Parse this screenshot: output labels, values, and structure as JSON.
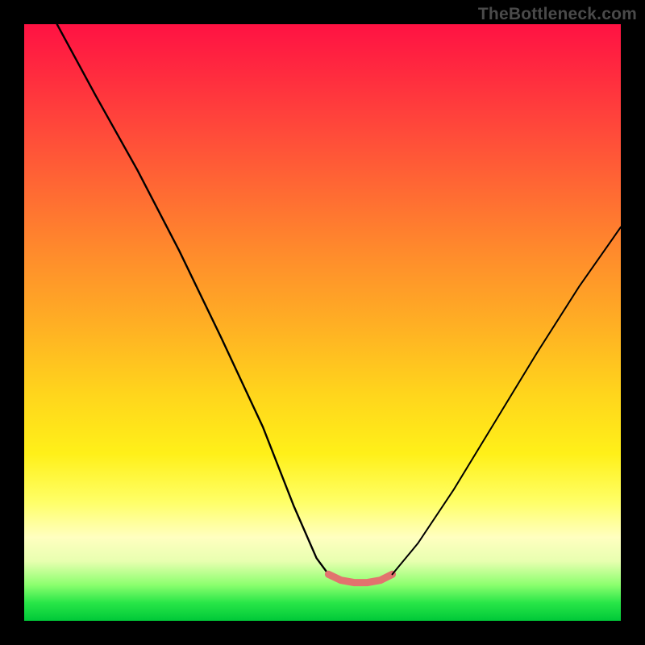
{
  "watermark": {
    "text": "TheBottleneck.com"
  },
  "colors": {
    "page_bg": "#000000",
    "watermark_text": "#4a4a4a",
    "curve": "#000000",
    "flat_segment": "#e2736e",
    "gradient_stops": [
      "#ff1243",
      "#ff2a3f",
      "#ff4a3a",
      "#ff6a33",
      "#ff8a2c",
      "#ffae24",
      "#ffd51c",
      "#fff019",
      "#ffff66",
      "#ffffc0",
      "#e8ffb0",
      "#8bff6e",
      "#28e648",
      "#00c838"
    ]
  },
  "chart_data": {
    "type": "line",
    "title": "",
    "xlabel": "",
    "ylabel": "",
    "xlim_norm": [
      0,
      1
    ],
    "ylim_norm": [
      0,
      1
    ],
    "series": [
      {
        "name": "left-descending-curve",
        "points_norm": [
          [
            0.055,
            0.0
          ],
          [
            0.12,
            0.12
          ],
          [
            0.19,
            0.245
          ],
          [
            0.26,
            0.38
          ],
          [
            0.33,
            0.525
          ],
          [
            0.4,
            0.675
          ],
          [
            0.452,
            0.808
          ],
          [
            0.49,
            0.895
          ],
          [
            0.51,
            0.922
          ]
        ]
      },
      {
        "name": "flat-minimum-segment",
        "color": "#e2736e",
        "points_norm": [
          [
            0.51,
            0.922
          ],
          [
            0.531,
            0.932
          ],
          [
            0.553,
            0.936
          ],
          [
            0.575,
            0.936
          ],
          [
            0.597,
            0.932
          ],
          [
            0.617,
            0.922
          ]
        ]
      },
      {
        "name": "right-ascending-curve",
        "points_norm": [
          [
            0.617,
            0.922
          ],
          [
            0.66,
            0.87
          ],
          [
            0.72,
            0.78
          ],
          [
            0.79,
            0.665
          ],
          [
            0.86,
            0.55
          ],
          [
            0.93,
            0.44
          ],
          [
            1.0,
            0.34
          ]
        ]
      }
    ],
    "note": "Coordinates are normalized to the plot area (0,0 = top-left, 1,1 = bottom-right). y increases downward."
  }
}
